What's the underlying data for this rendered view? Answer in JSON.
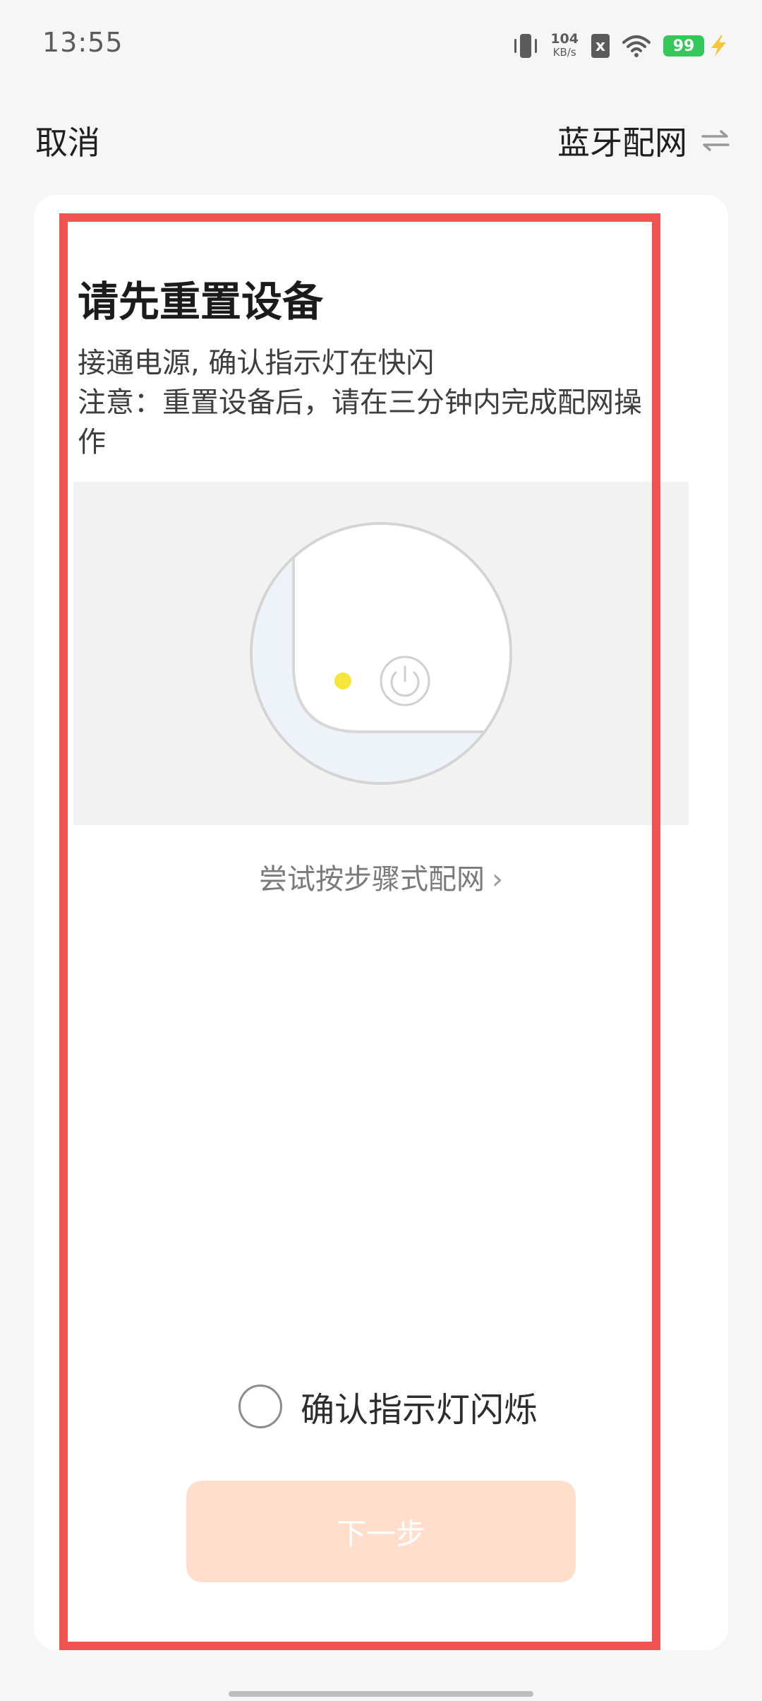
{
  "status_bar": {
    "time": "13:55",
    "net_speed_value": "104",
    "net_speed_unit": "KB/s",
    "sim_icon": "x",
    "battery": "99",
    "icons": [
      "vibrate-icon",
      "sim-off-icon",
      "wifi-icon",
      "battery-icon",
      "charging-bolt-icon"
    ]
  },
  "nav": {
    "cancel": "取消",
    "mode": "蓝牙配网",
    "mode_icon": "swap-arrows-icon"
  },
  "content": {
    "title": "请先重置设备",
    "desc_line1": "接通电源, 确认指示灯在快闪",
    "desc_line2": "注意：重置设备后，请在三分钟内完成配网操作",
    "step_link": "尝试按步骤式配网",
    "step_link_chevron": "›",
    "confirm_label": "确认指示灯闪烁",
    "next_button": "下一步"
  },
  "colors": {
    "highlight_border": "#ef534f",
    "indicator_light": "#f7e53b",
    "next_button_bg": "#ffdfcc",
    "battery_green": "#34c759"
  }
}
